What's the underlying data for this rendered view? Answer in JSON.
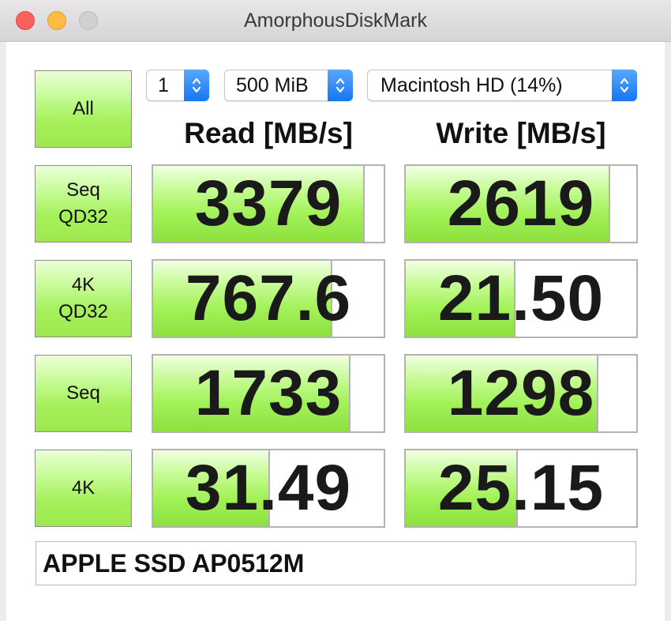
{
  "window": {
    "title": "AmorphousDiskMark"
  },
  "controls": {
    "count": "1",
    "size": "500 MiB",
    "drive": "Macintosh HD (14%)"
  },
  "headers": {
    "read": "Read [MB/s]",
    "write": "Write [MB/s]"
  },
  "tests": [
    {
      "label": "All"
    },
    {
      "label": "Seq\nQD32"
    },
    {
      "label": "4K\nQD32"
    },
    {
      "label": "Seq"
    },
    {
      "label": "4K"
    }
  ],
  "results": [
    {
      "test": "Seq QD32",
      "read": "3379",
      "read_fill": 0.91,
      "write": "2619",
      "write_fill": 0.88
    },
    {
      "test": "4K QD32",
      "read": "767.6",
      "read_fill": 0.77,
      "write": "21.50",
      "write_fill": 0.47
    },
    {
      "test": "Seq",
      "read": "1733",
      "read_fill": 0.85,
      "write": "1298",
      "write_fill": 0.83
    },
    {
      "test": "4K",
      "read": "31.49",
      "read_fill": 0.5,
      "write": "25.15",
      "write_fill": 0.48
    }
  ],
  "device_name": "APPLE SSD AP0512M"
}
